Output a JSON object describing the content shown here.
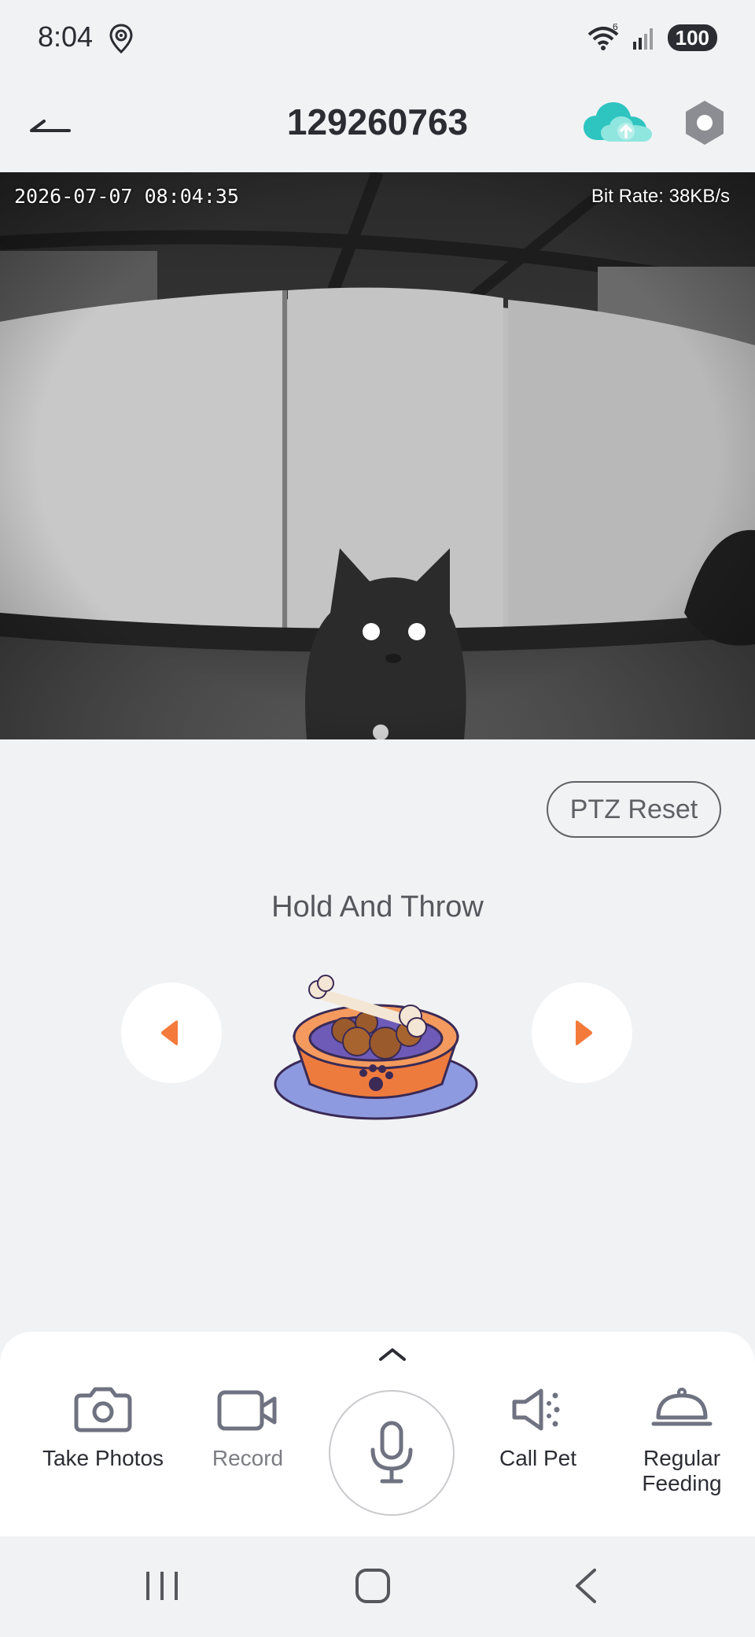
{
  "status_bar": {
    "time": "8:04",
    "battery": "100",
    "icons": [
      "location-icon",
      "wifi-icon",
      "cell-signal-icon"
    ]
  },
  "header": {
    "title": "129260763",
    "icons": [
      "back-arrow-icon",
      "cloud-upload-icon",
      "settings-hex-icon"
    ],
    "accent": "#2ec4c0"
  },
  "video": {
    "timestamp": "2026-07-07 08:04:35",
    "bitrate": "Bit Rate: 38KB/s"
  },
  "controls": {
    "ptz_reset": "PTZ Reset",
    "hold_throw": "Hold And Throw",
    "accent": "#f47a3b"
  },
  "toolbar": {
    "take_photos": "Take Photos",
    "record": "Record",
    "call_pet": "Call Pet",
    "regular_feeding": "Regular Feeding"
  },
  "nav": {
    "icons": [
      "recent-apps-icon",
      "home-icon",
      "back-icon"
    ]
  }
}
